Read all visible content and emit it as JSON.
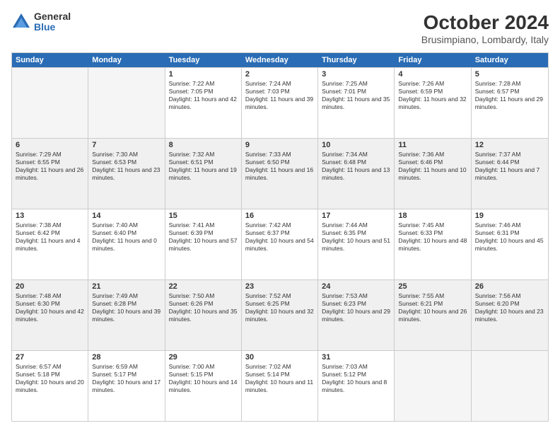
{
  "header": {
    "logo": {
      "general": "General",
      "blue": "Blue"
    },
    "title": "October 2024",
    "subtitle": "Brusimpiano, Lombardy, Italy"
  },
  "calendar": {
    "days_of_week": [
      "Sunday",
      "Monday",
      "Tuesday",
      "Wednesday",
      "Thursday",
      "Friday",
      "Saturday"
    ],
    "rows": [
      [
        {
          "day": "",
          "empty": true
        },
        {
          "day": "",
          "empty": true
        },
        {
          "day": "1",
          "sunrise": "Sunrise: 7:22 AM",
          "sunset": "Sunset: 7:05 PM",
          "daylight": "Daylight: 11 hours and 42 minutes."
        },
        {
          "day": "2",
          "sunrise": "Sunrise: 7:24 AM",
          "sunset": "Sunset: 7:03 PM",
          "daylight": "Daylight: 11 hours and 39 minutes."
        },
        {
          "day": "3",
          "sunrise": "Sunrise: 7:25 AM",
          "sunset": "Sunset: 7:01 PM",
          "daylight": "Daylight: 11 hours and 35 minutes."
        },
        {
          "day": "4",
          "sunrise": "Sunrise: 7:26 AM",
          "sunset": "Sunset: 6:59 PM",
          "daylight": "Daylight: 11 hours and 32 minutes."
        },
        {
          "day": "5",
          "sunrise": "Sunrise: 7:28 AM",
          "sunset": "Sunset: 6:57 PM",
          "daylight": "Daylight: 11 hours and 29 minutes."
        }
      ],
      [
        {
          "day": "6",
          "sunrise": "Sunrise: 7:29 AM",
          "sunset": "Sunset: 6:55 PM",
          "daylight": "Daylight: 11 hours and 26 minutes."
        },
        {
          "day": "7",
          "sunrise": "Sunrise: 7:30 AM",
          "sunset": "Sunset: 6:53 PM",
          "daylight": "Daylight: 11 hours and 23 minutes."
        },
        {
          "day": "8",
          "sunrise": "Sunrise: 7:32 AM",
          "sunset": "Sunset: 6:51 PM",
          "daylight": "Daylight: 11 hours and 19 minutes."
        },
        {
          "day": "9",
          "sunrise": "Sunrise: 7:33 AM",
          "sunset": "Sunset: 6:50 PM",
          "daylight": "Daylight: 11 hours and 16 minutes."
        },
        {
          "day": "10",
          "sunrise": "Sunrise: 7:34 AM",
          "sunset": "Sunset: 6:48 PM",
          "daylight": "Daylight: 11 hours and 13 minutes."
        },
        {
          "day": "11",
          "sunrise": "Sunrise: 7:36 AM",
          "sunset": "Sunset: 6:46 PM",
          "daylight": "Daylight: 11 hours and 10 minutes."
        },
        {
          "day": "12",
          "sunrise": "Sunrise: 7:37 AM",
          "sunset": "Sunset: 6:44 PM",
          "daylight": "Daylight: 11 hours and 7 minutes."
        }
      ],
      [
        {
          "day": "13",
          "sunrise": "Sunrise: 7:38 AM",
          "sunset": "Sunset: 6:42 PM",
          "daylight": "Daylight: 11 hours and 4 minutes."
        },
        {
          "day": "14",
          "sunrise": "Sunrise: 7:40 AM",
          "sunset": "Sunset: 6:40 PM",
          "daylight": "Daylight: 11 hours and 0 minutes."
        },
        {
          "day": "15",
          "sunrise": "Sunrise: 7:41 AM",
          "sunset": "Sunset: 6:39 PM",
          "daylight": "Daylight: 10 hours and 57 minutes."
        },
        {
          "day": "16",
          "sunrise": "Sunrise: 7:42 AM",
          "sunset": "Sunset: 6:37 PM",
          "daylight": "Daylight: 10 hours and 54 minutes."
        },
        {
          "day": "17",
          "sunrise": "Sunrise: 7:44 AM",
          "sunset": "Sunset: 6:35 PM",
          "daylight": "Daylight: 10 hours and 51 minutes."
        },
        {
          "day": "18",
          "sunrise": "Sunrise: 7:45 AM",
          "sunset": "Sunset: 6:33 PM",
          "daylight": "Daylight: 10 hours and 48 minutes."
        },
        {
          "day": "19",
          "sunrise": "Sunrise: 7:46 AM",
          "sunset": "Sunset: 6:31 PM",
          "daylight": "Daylight: 10 hours and 45 minutes."
        }
      ],
      [
        {
          "day": "20",
          "sunrise": "Sunrise: 7:48 AM",
          "sunset": "Sunset: 6:30 PM",
          "daylight": "Daylight: 10 hours and 42 minutes."
        },
        {
          "day": "21",
          "sunrise": "Sunrise: 7:49 AM",
          "sunset": "Sunset: 6:28 PM",
          "daylight": "Daylight: 10 hours and 39 minutes."
        },
        {
          "day": "22",
          "sunrise": "Sunrise: 7:50 AM",
          "sunset": "Sunset: 6:26 PM",
          "daylight": "Daylight: 10 hours and 35 minutes."
        },
        {
          "day": "23",
          "sunrise": "Sunrise: 7:52 AM",
          "sunset": "Sunset: 6:25 PM",
          "daylight": "Daylight: 10 hours and 32 minutes."
        },
        {
          "day": "24",
          "sunrise": "Sunrise: 7:53 AM",
          "sunset": "Sunset: 6:23 PM",
          "daylight": "Daylight: 10 hours and 29 minutes."
        },
        {
          "day": "25",
          "sunrise": "Sunrise: 7:55 AM",
          "sunset": "Sunset: 6:21 PM",
          "daylight": "Daylight: 10 hours and 26 minutes."
        },
        {
          "day": "26",
          "sunrise": "Sunrise: 7:56 AM",
          "sunset": "Sunset: 6:20 PM",
          "daylight": "Daylight: 10 hours and 23 minutes."
        }
      ],
      [
        {
          "day": "27",
          "sunrise": "Sunrise: 6:57 AM",
          "sunset": "Sunset: 5:18 PM",
          "daylight": "Daylight: 10 hours and 20 minutes."
        },
        {
          "day": "28",
          "sunrise": "Sunrise: 6:59 AM",
          "sunset": "Sunset: 5:17 PM",
          "daylight": "Daylight: 10 hours and 17 minutes."
        },
        {
          "day": "29",
          "sunrise": "Sunrise: 7:00 AM",
          "sunset": "Sunset: 5:15 PM",
          "daylight": "Daylight: 10 hours and 14 minutes."
        },
        {
          "day": "30",
          "sunrise": "Sunrise: 7:02 AM",
          "sunset": "Sunset: 5:14 PM",
          "daylight": "Daylight: 10 hours and 11 minutes."
        },
        {
          "day": "31",
          "sunrise": "Sunrise: 7:03 AM",
          "sunset": "Sunset: 5:12 PM",
          "daylight": "Daylight: 10 hours and 8 minutes."
        },
        {
          "day": "",
          "empty": true
        },
        {
          "day": "",
          "empty": true
        }
      ]
    ]
  }
}
